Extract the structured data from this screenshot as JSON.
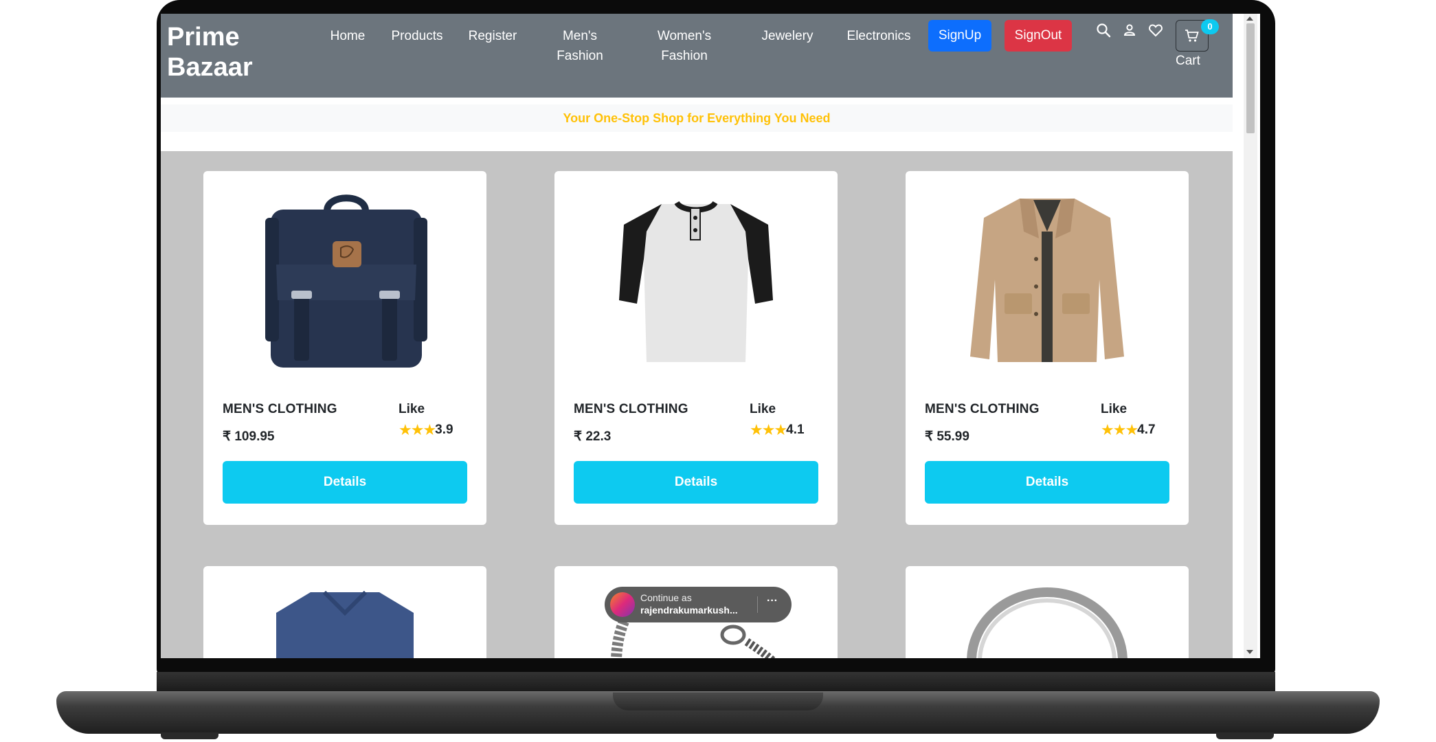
{
  "brand": {
    "line1": "Prime",
    "line2": "Bazaar"
  },
  "nav": {
    "home": "Home",
    "products": "Products",
    "register": "Register",
    "mens_line1": "Men's",
    "mens_line2": "Fashion",
    "womens_line1": "Women's",
    "womens_line2": "Fashion",
    "jewelery": "Jewelery",
    "electronics": "Electronics",
    "signup": "SignUp",
    "signout": "SignOut",
    "cart_label": "Cart",
    "cart_count": "0"
  },
  "tagline": "Your One-Stop Shop for Everything You Need",
  "products": [
    {
      "category": "MEN'S CLOTHING",
      "price": "₹ 109.95",
      "like": "Like",
      "stars": "★★★",
      "rating": "3.9",
      "button": "Details",
      "image": "backpack-image"
    },
    {
      "category": "MEN'S CLOTHING",
      "price": "₹ 22.3",
      "like": "Like",
      "stars": "★★★",
      "rating": "4.1",
      "button": "Details",
      "image": "tshirt-image"
    },
    {
      "category": "MEN'S CLOTHING",
      "price": "₹ 55.99",
      "like": "Like",
      "stars": "★★★",
      "rating": "4.7",
      "button": "Details",
      "image": "jacket-image"
    }
  ],
  "second_row_images": [
    "shirt-image",
    "bracelet-image",
    "ring-image"
  ],
  "toast": {
    "line1": "Continue as",
    "line2": "rajendrakumarkush...",
    "more": "···"
  },
  "colors": {
    "navbar": "#6c757d",
    "tagline": "#ffc107",
    "signup": "#0d6efd",
    "signout": "#dc3545",
    "details": "#0dcaf0",
    "star": "#ffc107",
    "background": "#c4c4c4"
  }
}
